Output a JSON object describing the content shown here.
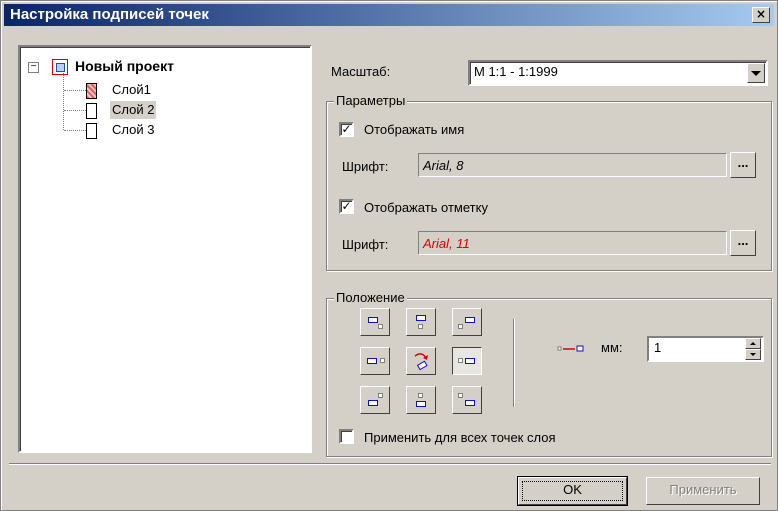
{
  "window": {
    "title": "Настройка подписей точек",
    "close_glyph": "×"
  },
  "tree": {
    "expander": "−",
    "root": "Новый проект",
    "layers": [
      "Слой1",
      "Слой 2",
      "Слой 3"
    ],
    "selected_index": 1
  },
  "scale": {
    "label": "Масштаб:",
    "value": "М 1:1 - 1:1999"
  },
  "params": {
    "group_title": "Параметры",
    "show_name_label": "Отображать имя",
    "show_name_checked": true,
    "font_label_1": "Шрифт:",
    "font_value_1": "Arial, 8",
    "font_color_1": "#000000",
    "show_mark_label": "Отображать отметку",
    "show_mark_checked": true,
    "font_label_2": "Шрифт:",
    "font_value_2": "Arial, 11",
    "font_color_2": "#e00000",
    "browse_label": "..."
  },
  "position": {
    "group_title": "Положение",
    "offset_unit": "мм:",
    "offset_value": "1",
    "apply_all_label": "Применить для всех точек слоя",
    "apply_all_checked": false,
    "selected_cell": "middle-right"
  },
  "buttons": {
    "ok": "OK",
    "apply": "Применить"
  },
  "colors": {
    "title_bar_start": "#0a246a",
    "title_bar_end": "#a6caf0",
    "face": "#d4d0c8",
    "mark": "#1010d0"
  }
}
